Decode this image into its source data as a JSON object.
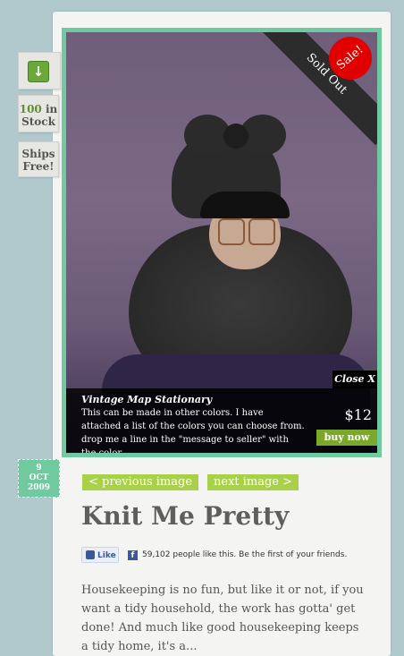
{
  "side_tabs": {
    "download_icon": "download-arrow-icon",
    "stock_count": "100",
    "stock_in": "in",
    "stock_label": "Stock",
    "ships_line1": "Ships",
    "ships_line2": "Free!"
  },
  "product": {
    "sold_out": "Sold Out",
    "sale_badge": "Sale!",
    "close_label": "Close  X",
    "caption_title": "Vintage Map Stationary",
    "caption_text": "This can be made in other colors. I have attached a list of the colors you can choose from. drop me a line in the \"message to seller\" with the color.",
    "price": "$12",
    "buy_label": "buy now"
  },
  "date": {
    "day": "9",
    "month": "OCT",
    "year": "2009"
  },
  "nav": {
    "previous": "< previous image",
    "next": "next image >"
  },
  "post": {
    "title": "Knit Me Pretty",
    "like_label": "Like",
    "like_text": "59,102 people like this. Be the first of your friends.",
    "body": "Housekeeping is no fun, but like it or not, if you want a tidy household, the work has gotta' get done!  And much like good housekeeping keeps a tidy home, it's a..."
  },
  "colors": {
    "background": "#b1c9cd",
    "frame": "#6fcaa0",
    "nav": "#a8d048",
    "buy": "#7aa82b",
    "sale": "#e00000"
  }
}
